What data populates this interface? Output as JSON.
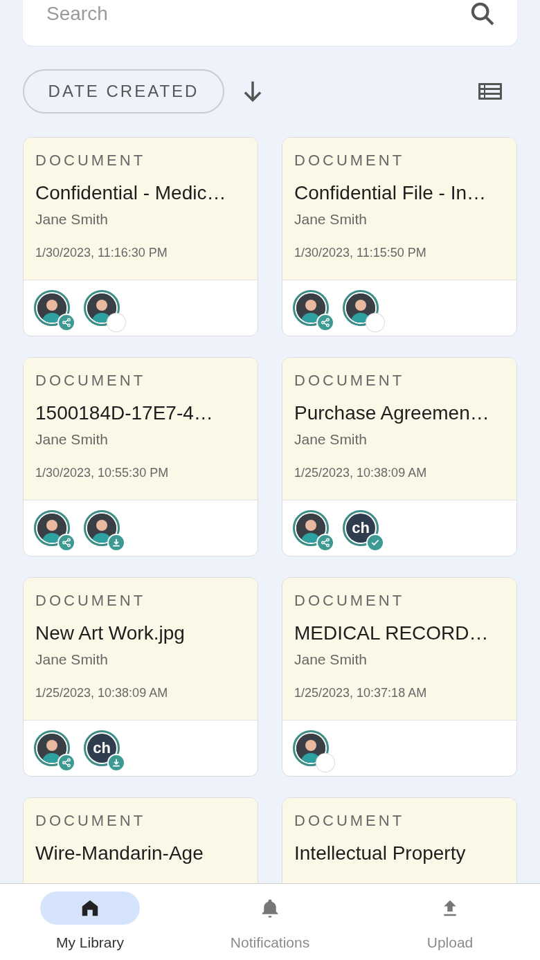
{
  "search": {
    "placeholder": "Search"
  },
  "sort": {
    "label": "DATE CREATED"
  },
  "documents": [
    {
      "type": "DOCUMENT",
      "title": "Confidential - Medic…",
      "owner": "Jane Smith",
      "date": "1/30/2023, 11:16:30 PM",
      "people": [
        {
          "kind": "figure",
          "badge": {
            "kind": "share"
          }
        },
        {
          "kind": "figure",
          "badge": {
            "kind": "empty"
          }
        }
      ]
    },
    {
      "type": "DOCUMENT",
      "title": "Confidential File - In…",
      "owner": "Jane Smith",
      "date": "1/30/2023, 11:15:50 PM",
      "people": [
        {
          "kind": "figure",
          "badge": {
            "kind": "share"
          }
        },
        {
          "kind": "figure",
          "badge": {
            "kind": "empty"
          }
        }
      ]
    },
    {
      "type": "DOCUMENT",
      "title": "1500184D-17E7-4…",
      "owner": "Jane Smith",
      "date": "1/30/2023, 10:55:30 PM",
      "people": [
        {
          "kind": "figure",
          "badge": {
            "kind": "share"
          }
        },
        {
          "kind": "figure",
          "badge": {
            "kind": "download"
          }
        }
      ]
    },
    {
      "type": "DOCUMENT",
      "title": "Purchase Agreemen…",
      "owner": "Jane Smith",
      "date": "1/25/2023, 10:38:09 AM",
      "people": [
        {
          "kind": "figure",
          "badge": {
            "kind": "share"
          }
        },
        {
          "kind": "initials",
          "initials": "ch",
          "badge": {
            "kind": "check"
          }
        }
      ]
    },
    {
      "type": "DOCUMENT",
      "title": "New Art Work.jpg",
      "owner": "Jane Smith",
      "date": "1/25/2023, 10:38:09 AM",
      "people": [
        {
          "kind": "figure",
          "badge": {
            "kind": "share"
          }
        },
        {
          "kind": "initials",
          "initials": "ch",
          "badge": {
            "kind": "download"
          }
        }
      ]
    },
    {
      "type": "DOCUMENT",
      "title": "MEDICAL RECORD…",
      "owner": "Jane Smith",
      "date": "1/25/2023, 10:37:18 AM",
      "people": [
        {
          "kind": "figure",
          "badge": {
            "kind": "empty"
          }
        }
      ]
    },
    {
      "type": "DOCUMENT",
      "title": "Wire-Mandarin-Age"
    },
    {
      "type": "DOCUMENT",
      "title": "Intellectual Property"
    }
  ],
  "nav": [
    {
      "label": "My Library",
      "kind": "home",
      "selected": true
    },
    {
      "label": "Notifications",
      "kind": "bell",
      "selected": false
    },
    {
      "label": "Upload",
      "kind": "upload",
      "selected": false
    }
  ]
}
